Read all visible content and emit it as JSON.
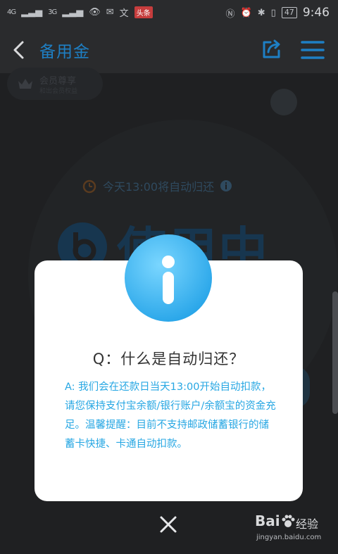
{
  "status_bar": {
    "signal1": "4G",
    "signal2": "3G",
    "news_badge": "头条",
    "battery": "47",
    "time": "9:46"
  },
  "header": {
    "title": "备用金"
  },
  "background": {
    "member_title": "会员尊享",
    "member_subtitle": "和出会员权益",
    "repay_notice": "今天13:00将自动归还",
    "status_text": "使用中"
  },
  "dialog": {
    "question": "Q：什么是自动归还？",
    "answer": "A: 我们会在还款日当天13:00开始自动扣款，请您保持支付宝余额/银行账户/余额宝的资金充足。温馨提醒：目前不支持邮政储蓄银行的储蓄卡快捷、卡通自动扣款。"
  },
  "watermark": {
    "brand": "Bai",
    "brand_suffix": "经验",
    "url": "jingyan.baidu.com"
  },
  "colors": {
    "accent": "#1e7fc4",
    "answer_text": "#27a7e3",
    "overlay": "#1a1b1d"
  },
  "icons": [
    "back-icon",
    "share-icon",
    "menu-icon",
    "crown-icon",
    "clock-icon",
    "info-icon",
    "close-icon",
    "paw-icon"
  ]
}
